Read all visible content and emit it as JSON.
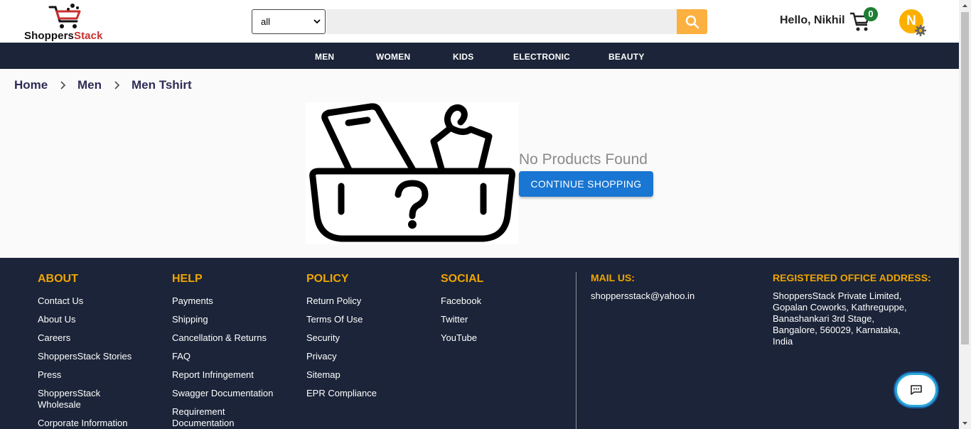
{
  "header": {
    "logo_text_1": "Shoppers",
    "logo_text_2": "Stack",
    "category_select": "all",
    "search_placeholder": "",
    "greeting": "Hello, Nikhil",
    "cart_count": "0",
    "avatar_letter": "N",
    "icons": {
      "logo": "shopping-cart-logo-icon",
      "search": "search-icon",
      "cart": "cart-icon",
      "settings": "gear-icon"
    }
  },
  "nav": {
    "items": [
      "MEN",
      "WOMEN",
      "KIDS",
      "ELECTRONIC",
      "BEAUTY"
    ]
  },
  "breadcrumb": [
    "Home",
    "Men",
    "Men Tshirt"
  ],
  "empty_state": {
    "message": "No Products Found",
    "button": "CONTINUE SHOPPING",
    "illustration": "empty-box-icon"
  },
  "footer": {
    "about": {
      "title": "ABOUT",
      "links": [
        "Contact Us",
        "About Us",
        "Careers",
        "ShoppersStack Stories",
        "Press",
        "ShoppersStack Wholesale",
        "Corporate Information"
      ]
    },
    "help": {
      "title": "HELP",
      "links": [
        "Payments",
        "Shipping",
        "Cancellation & Returns",
        "FAQ",
        "Report Infringement",
        "Swagger Documentation",
        "Requirement Documentation"
      ]
    },
    "policy": {
      "title": "POLICY",
      "links": [
        "Return Policy",
        "Terms Of Use",
        "Security",
        "Privacy",
        "Sitemap",
        "EPR Compliance"
      ]
    },
    "social": {
      "title": "SOCIAL",
      "links": [
        "Facebook",
        "Twitter",
        "YouTube"
      ]
    },
    "mail": {
      "title": "MAIL US:",
      "email": "shoppersstack@yahoo.in"
    },
    "office": {
      "title": "REGISTERED OFFICE ADDRESS:",
      "lines": [
        "ShoppersStack Private Limited,",
        "Gopalan Coworks, Kathreguppe,",
        "Banashankari 3rd Stage,",
        "Bangalore, 560029, Karnataka,",
        "India"
      ]
    }
  },
  "chat": {
    "icon": "chat-icon"
  },
  "colors": {
    "nav_bg": "#1b2438",
    "accent": "#f0a500",
    "search_button": "#fbb040",
    "primary_button": "#1976d2",
    "cart_badge": "#1e7e34",
    "logo_red": "#c92f2f"
  }
}
